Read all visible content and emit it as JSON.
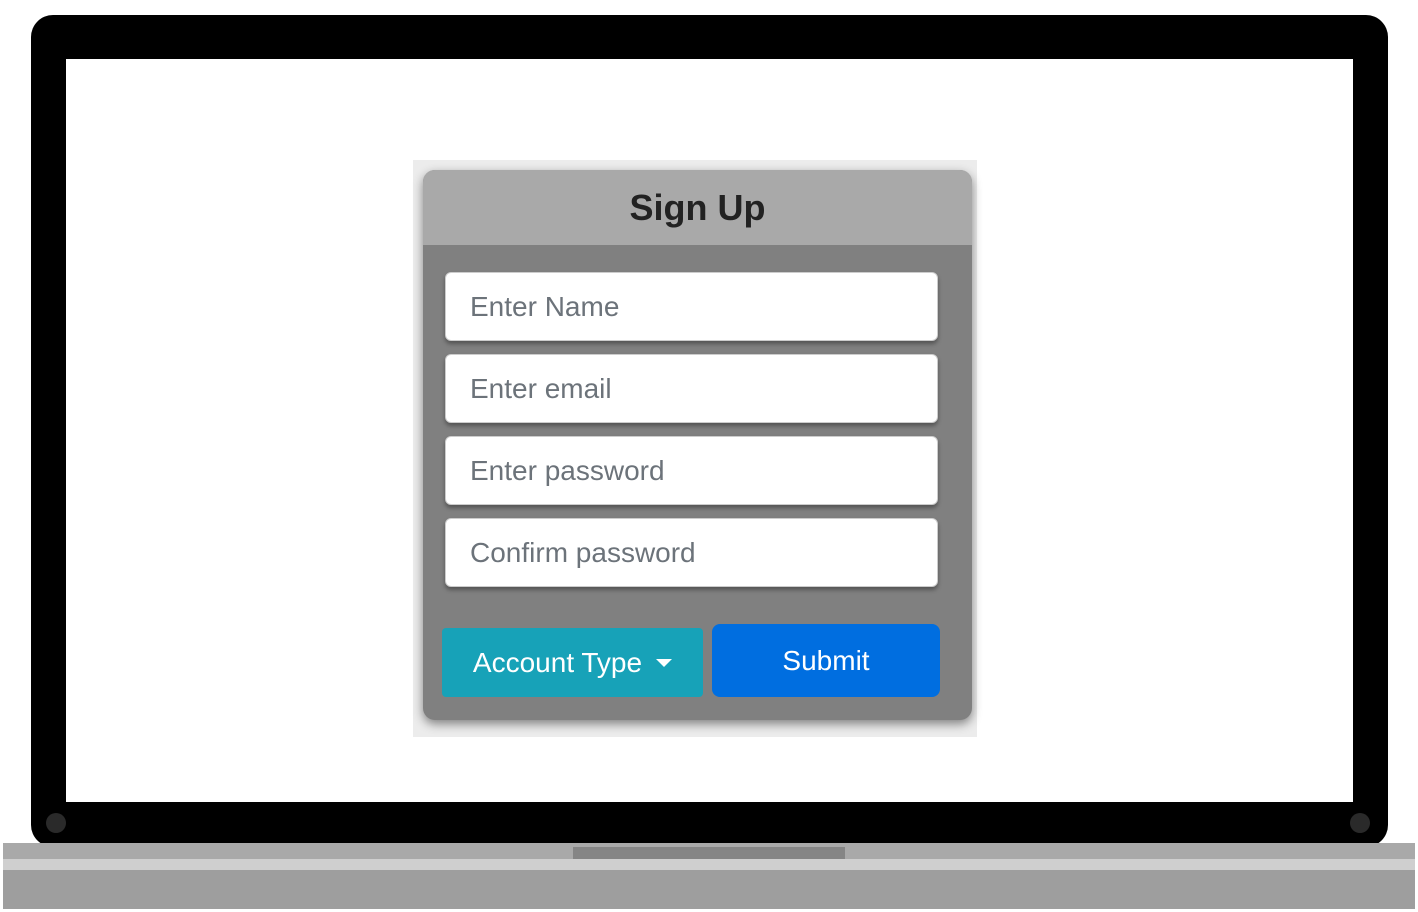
{
  "form": {
    "title": "Sign Up",
    "fields": [
      {
        "placeholder": "Enter Name",
        "value": ""
      },
      {
        "placeholder": "Enter email",
        "value": ""
      },
      {
        "placeholder": "Enter password",
        "value": ""
      },
      {
        "placeholder": "Confirm password",
        "value": ""
      }
    ],
    "account_type_label": "Account Type",
    "submit_label": "Submit"
  },
  "colors": {
    "account_button": "#17a2b8",
    "submit_button": "#006ee0",
    "card_body": "#808080",
    "card_header": "#a9a9a9"
  },
  "icons": {
    "dropdown_caret": "chevron-down-icon"
  }
}
